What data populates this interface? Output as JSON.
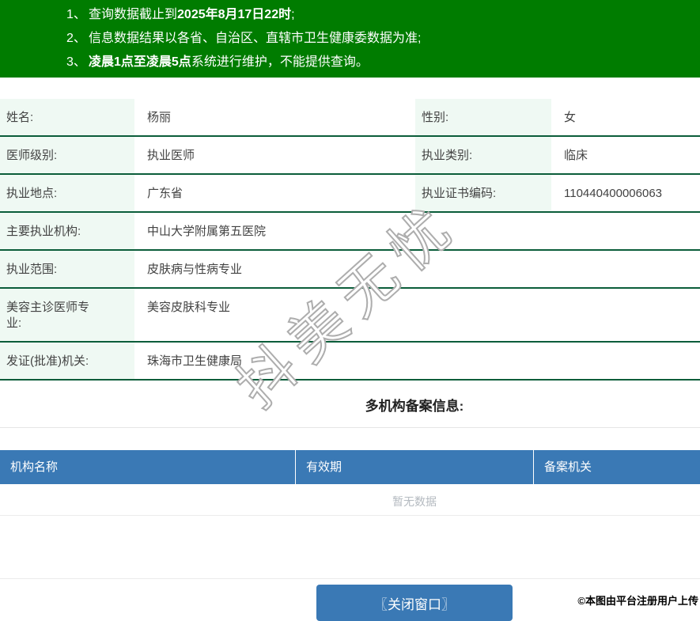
{
  "colors": {
    "banner_green": "#007C00",
    "row_divider_green": "#0B5D3A",
    "label_cell_bg": "#EFF9F3",
    "table_header_blue": "#3A79B5",
    "empty_text_gray": "#B4BAC0"
  },
  "notices": {
    "items": [
      {
        "num": "1、",
        "segments": [
          {
            "text": "查询数据截止到"
          },
          {
            "text": "2025年8月17日22时",
            "bold": true
          },
          {
            "text": ";"
          }
        ]
      },
      {
        "num": "2、",
        "segments": [
          {
            "text": "信息数据结果以各省、自治区、直辖市卫生健康委数据为准;"
          }
        ]
      },
      {
        "num": "3、",
        "segments": [
          {
            "text": "凌晨1点至凌晨5点",
            "bold": true
          },
          {
            "text": "系统进行维护，不能提供查询。"
          }
        ]
      }
    ]
  },
  "doctor": {
    "rows": [
      {
        "cells": [
          {
            "label": "姓名:",
            "value": "杨丽"
          },
          {
            "label": "性别:",
            "value": "女"
          }
        ]
      },
      {
        "cells": [
          {
            "label": "医师级别:",
            "value": "执业医师"
          },
          {
            "label": "执业类别:",
            "value": "临床"
          }
        ]
      },
      {
        "cells": [
          {
            "label": "执业地点:",
            "value": "广东省"
          },
          {
            "label": "执业证书编码:",
            "value": "110440400006063"
          }
        ]
      },
      {
        "cells": [
          {
            "label": "主要执业机构:",
            "value": "中山大学附属第五医院"
          }
        ]
      },
      {
        "cells": [
          {
            "label": "执业范围:",
            "value": "皮肤病与性病专业"
          }
        ]
      },
      {
        "cells": [
          {
            "label": "美容主诊医师专业:",
            "value": "美容皮肤科专业"
          }
        ]
      },
      {
        "cells": [
          {
            "label": "发证(批准)机关:",
            "value": "珠海市卫生健康局"
          }
        ]
      }
    ]
  },
  "org_section": {
    "title": "多机构备案信息:",
    "headers": [
      "机构名称",
      "有效期",
      "备案机关"
    ],
    "empty_text": "暂无数据"
  },
  "footer": {
    "close_label": "〖关闭窗口〗"
  },
  "watermark": {
    "text": "抖美无忧"
  },
  "stamp": {
    "text": "©本图由平台注册用户上传"
  }
}
